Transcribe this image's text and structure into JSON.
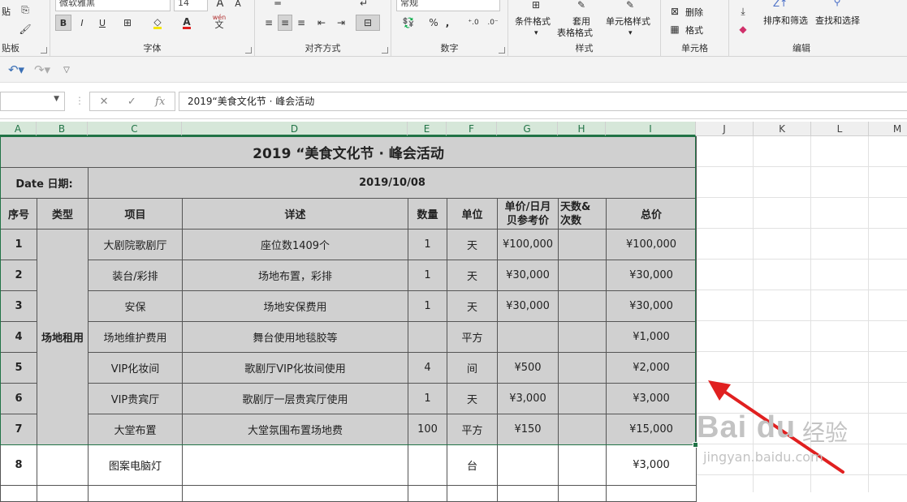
{
  "ribbon": {
    "clipboard": {
      "label": "贴板",
      "paste_label": "贴"
    },
    "font": {
      "label": "字体",
      "name": "微软雅黑",
      "size": "14",
      "bold": "B",
      "italic": "I",
      "underline": "U",
      "grow": "A",
      "shrink": "A",
      "wen": "wén",
      "wen_sub": "文"
    },
    "align": {
      "label": "对齐方式"
    },
    "number": {
      "label": "数字",
      "format": "常规",
      "percent": "%",
      "comma": ","
    },
    "style": {
      "label": "样式",
      "cond": "条件格式",
      "table": "套用",
      "table2": "表格格式",
      "cellstyle": "单元格样式"
    },
    "cells": {
      "label": "单元格",
      "delete": "删除",
      "format": "格式"
    },
    "edit": {
      "label": "编辑",
      "sort": "排序和筛选",
      "find": "查找和选择"
    }
  },
  "formula_bar": {
    "fx": "fx",
    "content": "2019“美食文化节 · 峰会活动"
  },
  "columns": [
    "A",
    "B",
    "C",
    "D",
    "E",
    "F",
    "G",
    "H",
    "I",
    "J",
    "K",
    "L",
    "M"
  ],
  "sheet": {
    "title": "2019 “美食文化节 · 峰会活动",
    "date_label": "Date  日期:",
    "date_value": "2019/10/08",
    "headers": {
      "no": "序号",
      "type": "类型",
      "item": "项目",
      "detail": "详述",
      "qty": "数量",
      "unit": "单位",
      "price1": "单价/日月",
      "price2": "贝参考价",
      "days1": "天数&",
      "days2": "次数",
      "total": "总价"
    },
    "category": "场地租用",
    "rows": [
      {
        "no": "1",
        "item": "大剧院歌剧厅",
        "detail": "座位数1409个",
        "qty": "1",
        "unit": "天",
        "price": "¥100,000",
        "days": "",
        "total": "¥100,000"
      },
      {
        "no": "2",
        "item": "装台/彩排",
        "detail": "场地布置，彩排",
        "qty": "1",
        "unit": "天",
        "price": "¥30,000",
        "days": "",
        "total": "¥30,000"
      },
      {
        "no": "3",
        "item": "安保",
        "detail": "场地安保费用",
        "qty": "1",
        "unit": "天",
        "price": "¥30,000",
        "days": "",
        "total": "¥30,000"
      },
      {
        "no": "4",
        "item": "场地维护费用",
        "detail": "舞台使用地毯胶等",
        "qty": "",
        "unit": "平方",
        "price": "",
        "days": "",
        "total": "¥1,000"
      },
      {
        "no": "5",
        "item": "VIP化妆间",
        "detail": "歌剧厅VIP化妆间使用",
        "qty": "4",
        "unit": "间",
        "price": "¥500",
        "days": "",
        "total": "¥2,000"
      },
      {
        "no": "6",
        "item": "VIP贵宾厅",
        "detail": "歌剧厅一层贵宾厅使用",
        "qty": "1",
        "unit": "天",
        "price": "¥3,000",
        "days": "",
        "total": "¥3,000"
      },
      {
        "no": "7",
        "item": "大堂布置",
        "detail": "大堂氛围布置场地费",
        "qty": "100",
        "unit": "平方",
        "price": "¥150",
        "days": "",
        "total": "¥15,000"
      }
    ],
    "row8": {
      "no": "8",
      "item": "图案电脑灯",
      "detail": "",
      "qty": "",
      "unit": "台",
      "price": "",
      "days": "",
      "total": "¥3,000"
    }
  },
  "watermark": {
    "logo": "Bai du",
    "cn": "经验",
    "url": "jingyan.baidu.com"
  },
  "colors": {
    "accent": "#217346",
    "arrow": "#e02020",
    "selected_fill": "#d0d0d0"
  }
}
